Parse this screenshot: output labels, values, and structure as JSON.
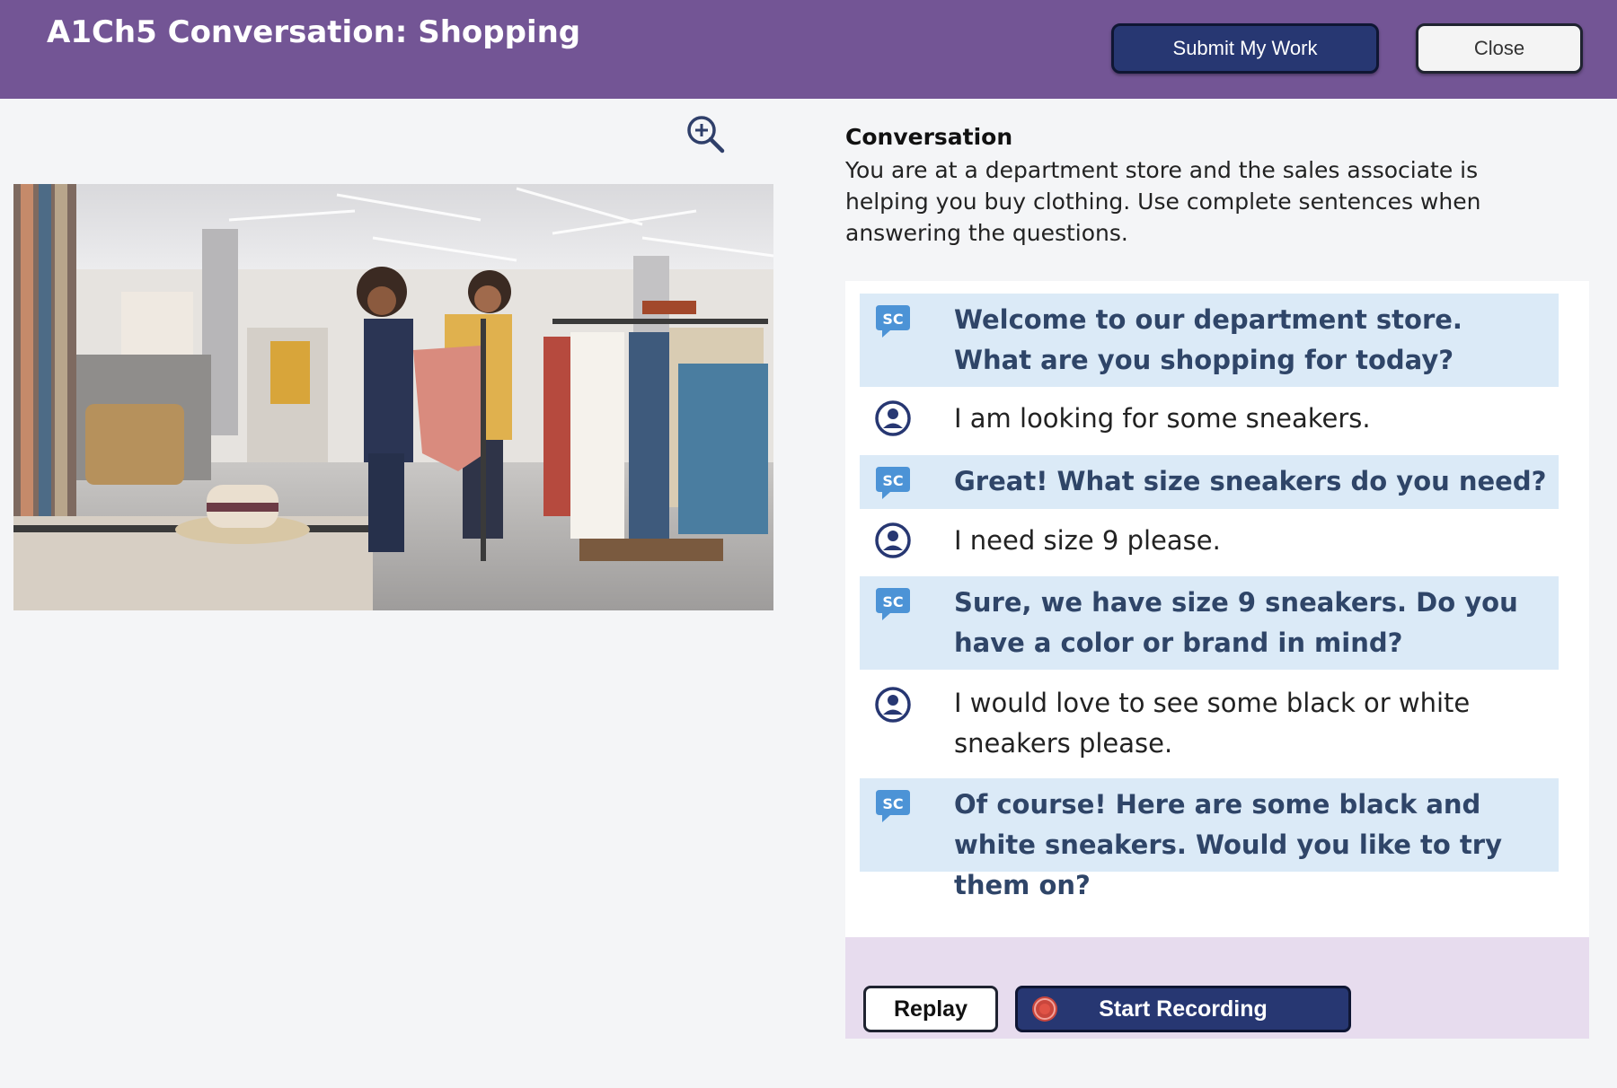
{
  "header": {
    "title": "A1Ch5 Conversation: Shopping",
    "submit_label": "Submit My Work",
    "close_label": "Close",
    "background_color": "#735595"
  },
  "image": {
    "zoom_icon": "zoom-in-icon"
  },
  "conversation": {
    "heading": "Conversation",
    "description": "You are at a department store and the sales associate is helping you buy clothing. Use complete sentences when answering the questions.",
    "messages": [
      {
        "speaker": "sc",
        "icon": "sc-speech-bubble-icon",
        "text": "Welcome to our department store. What are you shopping for today?"
      },
      {
        "speaker": "user",
        "icon": "user-circle-icon",
        "text": "I am looking for some sneakers."
      },
      {
        "speaker": "sc",
        "icon": "sc-speech-bubble-icon",
        "text": "Great! What size sneakers do you need?"
      },
      {
        "speaker": "user",
        "icon": "user-circle-icon",
        "text": "I need size 9 please."
      },
      {
        "speaker": "sc",
        "icon": "sc-speech-bubble-icon",
        "text": "Sure, we have size 9 sneakers. Do you have a color or brand in mind?"
      },
      {
        "speaker": "user",
        "icon": "user-circle-icon",
        "text": "I would love to see some black or white sneakers please."
      },
      {
        "speaker": "sc",
        "icon": "sc-speech-bubble-icon",
        "text": "Of course! Here are some black and white sneakers. Would you like to try them on?"
      }
    ]
  },
  "controls": {
    "replay_label": "Replay",
    "record_label": "Start Recording",
    "record_icon": "record-icon"
  },
  "colors": {
    "accent": "#273772",
    "sc_row": "#dbeaf7",
    "sc_text": "#2f4568",
    "footer": "#e7dcee"
  }
}
